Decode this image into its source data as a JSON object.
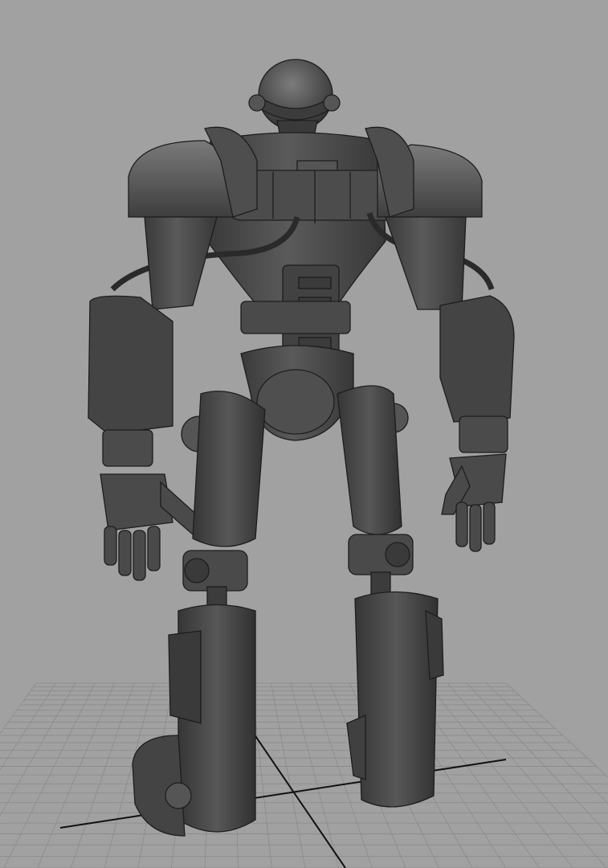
{
  "viewport": {
    "background_color": "#a1a1a1",
    "grid_color": "#8a8a8a",
    "grid_axis_color": "#111111",
    "model_base_color": "#4a4a4a",
    "model_highlight_color": "#6e6e6e",
    "model_shadow_color": "#2c2c2c",
    "edge_color": "#1d1d1d"
  }
}
